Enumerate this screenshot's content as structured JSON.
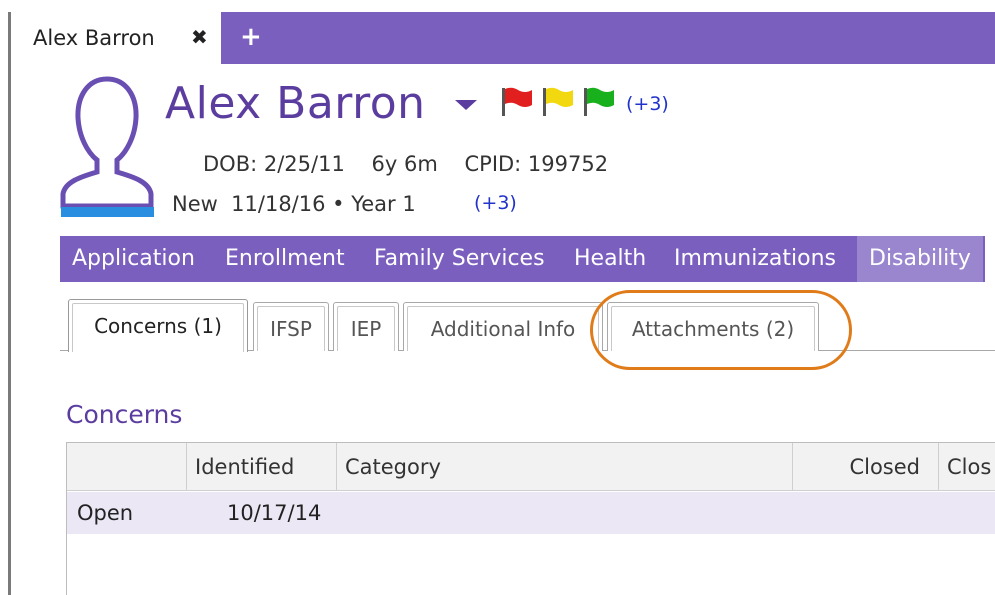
{
  "window": {
    "tab_title": "Alex Barron",
    "close_glyph": "✖",
    "new_tab_glyph": "+"
  },
  "profile": {
    "name": "Alex Barron",
    "flags": [
      {
        "color": "#e21f1f",
        "name": "red-flag-icon"
      },
      {
        "color": "#f2d90f",
        "name": "yellow-flag-icon"
      },
      {
        "color": "#19b01d",
        "name": "green-flag-icon"
      }
    ],
    "flags_more": "(+3)",
    "info_line1": "DOB: 2/25/11    6y 6m    CPID: 199752",
    "info_line2": "New  11/18/16 • Year 1",
    "info_more": "(+3)",
    "avatar_color": "#6a4fb3",
    "avatar_bar_color": "#2a8ee0"
  },
  "nav": {
    "items": [
      "Application",
      "Enrollment",
      "Family Services",
      "Health",
      "Immunizations",
      "Disability"
    ],
    "active": "Disability"
  },
  "subtabs": [
    {
      "label": "Concerns (1)",
      "active": true
    },
    {
      "label": "IFSP",
      "active": false
    },
    {
      "label": "IEP",
      "active": false
    },
    {
      "label": "Additional Info",
      "active": false
    },
    {
      "label": "Attachments (2)",
      "active": false
    }
  ],
  "highlight_color": "#e07b1a",
  "concerns": {
    "title": "Concerns",
    "columns": [
      "",
      "Identified",
      "Category",
      "Closed",
      "Clos"
    ],
    "rows": [
      {
        "status": "Open",
        "identified": "10/17/14",
        "category": "",
        "closed": ""
      }
    ]
  }
}
